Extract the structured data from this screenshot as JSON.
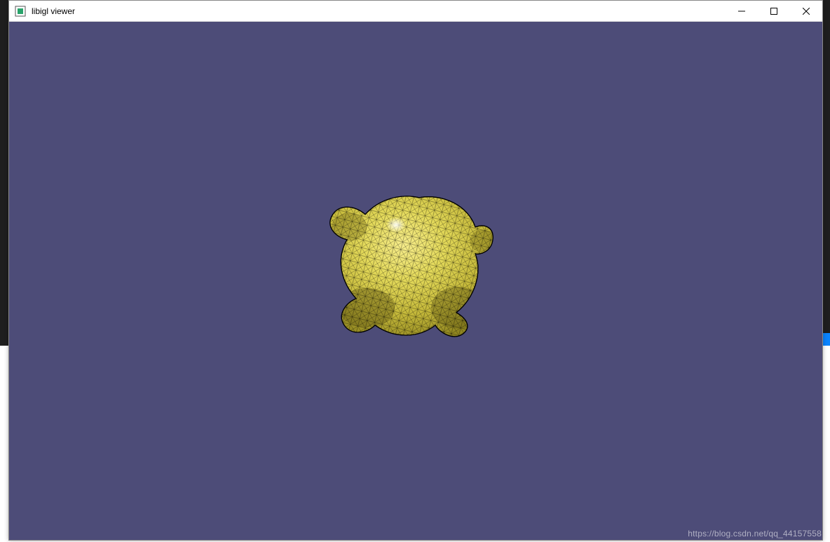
{
  "window": {
    "title": "libigl viewer"
  },
  "viewport": {
    "background_color": "#4d4c78",
    "mesh_color": "#e3d95a",
    "wireframe_color": "#000000"
  },
  "watermark": "https://blog.csdn.net/qq_44157558"
}
